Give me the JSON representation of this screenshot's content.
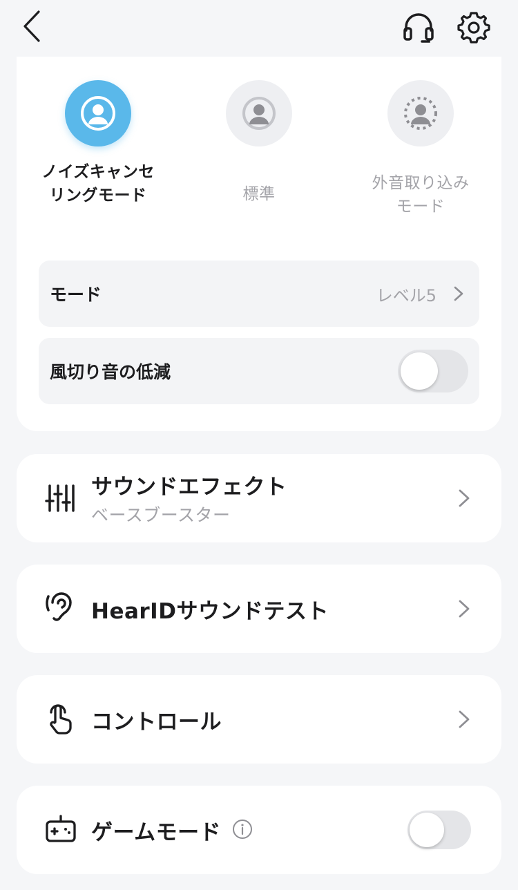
{
  "header": {
    "back_icon": "chevron-left-icon",
    "headset_icon": "headset-icon",
    "settings_icon": "gear-icon"
  },
  "anc": {
    "modes": [
      {
        "label": "ノイズキャンセリングモード",
        "icon": "anc-person-icon",
        "active": true
      },
      {
        "label": "標準",
        "icon": "normal-person-icon",
        "active": false
      },
      {
        "label": "外音取り込みモード",
        "icon": "transparency-person-icon",
        "active": false
      }
    ],
    "mode_row": {
      "label": "モード",
      "value": "レベル5"
    },
    "wind_row": {
      "label": "風切り音の低減",
      "toggle_on": false
    }
  },
  "menu": {
    "sound_effect": {
      "title": "サウンドエフェクト",
      "subtitle": "ベースブースター",
      "icon": "equalizer-sliders-icon"
    },
    "hearid": {
      "title": "HearIDサウンドテスト",
      "icon": "ear-icon"
    },
    "controls": {
      "title": "コントロール",
      "icon": "tap-hand-icon"
    },
    "game_mode": {
      "title": "ゲームモード",
      "icon": "gamepad-icon",
      "toggle_on": false
    }
  },
  "colors": {
    "accent": "#5ab8ea",
    "background": "#f5f6f8",
    "card": "#ffffff",
    "muted_text": "#a3a3a8"
  }
}
